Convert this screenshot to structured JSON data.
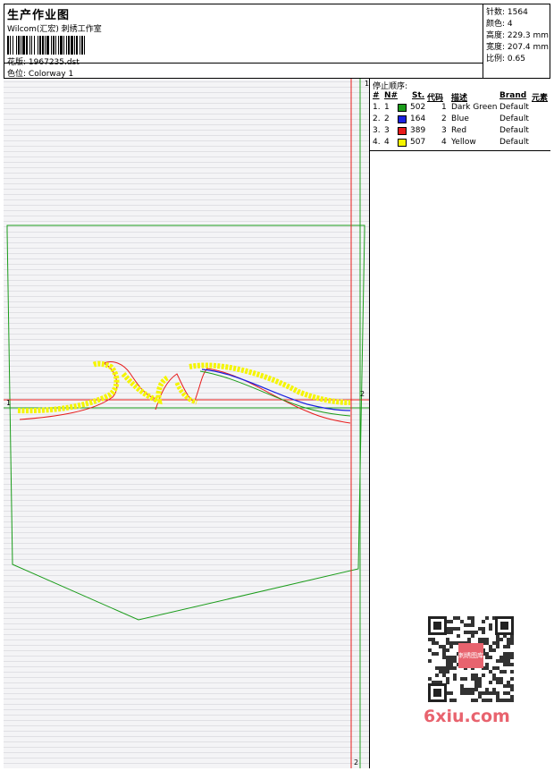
{
  "header": {
    "title": "生产作业图",
    "company": "Wilcom(汇宏) 刺绣工作室",
    "design_label": "花版:",
    "design_file": "1967235.dst",
    "colorway_label": "色位:",
    "colorway": "Colorway 1"
  },
  "stats": {
    "stitches": "针数: 1564",
    "colors": "颜色: 4",
    "height": "高度: 229.3 mm",
    "width": "宽度: 207.4 mm",
    "scale": "比例: 0.65"
  },
  "color_table": {
    "title": "停止顺序:",
    "headers": {
      "idx": "#",
      "no": "N#",
      "st": "St.",
      "code": "代码",
      "desc": "描述",
      "brand": "Brand",
      "element": "元素"
    },
    "rows": [
      {
        "idx": "1.",
        "no": "1",
        "color": "#1a9c1a",
        "st": "502",
        "code": "1",
        "desc": "Dark Green",
        "brand": "Default"
      },
      {
        "idx": "2.",
        "no": "2",
        "color": "#1b22e0",
        "st": "164",
        "code": "2",
        "desc": "Blue",
        "brand": "Default"
      },
      {
        "idx": "3.",
        "no": "3",
        "color": "#e81b1b",
        "st": "389",
        "code": "3",
        "desc": "Red",
        "brand": "Default"
      },
      {
        "idx": "4.",
        "no": "4",
        "color": "#f5f500",
        "st": "507",
        "code": "4",
        "desc": "Yellow",
        "brand": "Default"
      }
    ]
  },
  "markers": {
    "v1": "1",
    "h2": "2",
    "h1": "1",
    "v2": "2"
  },
  "watermark": "6xiu.com",
  "qr_badge": "刺绣图库"
}
